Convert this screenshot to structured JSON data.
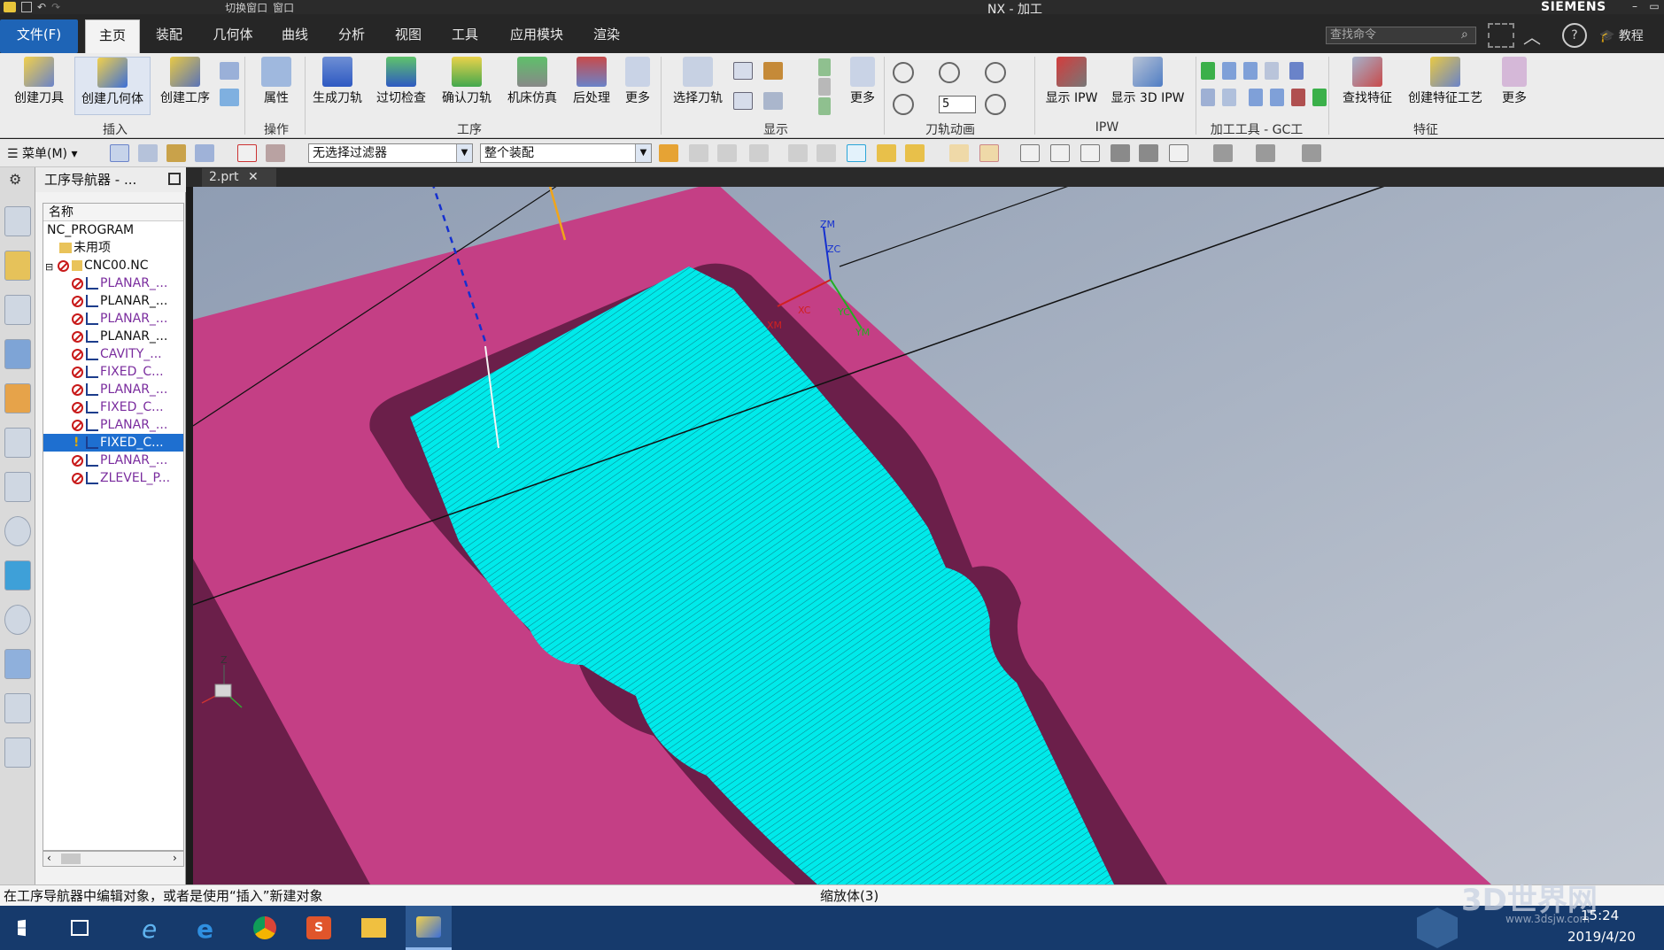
{
  "app": {
    "title": "NX - 加工",
    "brand": "SIEMENS",
    "quick_access": [
      "切换窗口",
      "窗口"
    ]
  },
  "menu": {
    "file": "文件(F)",
    "tabs": [
      "主页",
      "装配",
      "几何体",
      "曲线",
      "分析",
      "视图",
      "工具",
      "应用模块",
      "渲染"
    ],
    "active_tab": "主页",
    "search_placeholder": "查找命令",
    "tutorial": "教程"
  },
  "ribbon": {
    "insert": {
      "label": "插入",
      "buttons": [
        "创建刀具",
        "创建几何体",
        "创建工序"
      ]
    },
    "operate": {
      "label": "操作",
      "buttons": [
        "属性"
      ]
    },
    "process": {
      "label": "工序",
      "buttons": [
        "生成刀轨",
        "过切检查",
        "确认刀轨",
        "机床仿真",
        "后处理",
        "更多"
      ]
    },
    "display": {
      "label": "显示",
      "buttons": [
        "选择刀轨",
        "更多"
      ]
    },
    "animation": {
      "label": "刀轨动画",
      "speed": "5"
    },
    "ipw": {
      "label": "IPW",
      "buttons": [
        "显示 IPW",
        "显示 3D IPW"
      ]
    },
    "machining_tools": {
      "label": "加工工具 - GC工"
    },
    "features": {
      "label": "特征",
      "buttons": [
        "查找特征",
        "创建特征工艺",
        "更多"
      ]
    }
  },
  "toolbar": {
    "menu_label": "菜单(M)",
    "filter": "无选择过滤器",
    "scope": "整个装配"
  },
  "document_tab": "2.prt",
  "navigator": {
    "title": "工序导航器 - ...",
    "column": "名称",
    "root": "NC_PROGRAM",
    "unused": "未用项",
    "program": "CNC00.NC",
    "operations": [
      {
        "name": "PLANAR_...",
        "status": "stop",
        "color": "purple",
        "type": "planar"
      },
      {
        "name": "PLANAR_...",
        "status": "stop",
        "color": "black",
        "type": "planar"
      },
      {
        "name": "PLANAR_...",
        "status": "stop",
        "color": "purple",
        "type": "planar"
      },
      {
        "name": "PLANAR_...",
        "status": "stop",
        "color": "black",
        "type": "planar"
      },
      {
        "name": "CAVITY_...",
        "status": "stop",
        "color": "purple",
        "type": "cavity"
      },
      {
        "name": "FIXED_C...",
        "status": "stop",
        "color": "purple",
        "type": "fixed"
      },
      {
        "name": "PLANAR_...",
        "status": "stop",
        "color": "purple",
        "type": "planar"
      },
      {
        "name": "FIXED_C...",
        "status": "stop",
        "color": "purple",
        "type": "fixed"
      },
      {
        "name": "PLANAR_...",
        "status": "stop",
        "color": "purple",
        "type": "planar"
      },
      {
        "name": "FIXED_C...",
        "status": "warn",
        "color": "selected",
        "type": "fixed"
      },
      {
        "name": "PLANAR_...",
        "status": "stop",
        "color": "purple",
        "type": "planar"
      },
      {
        "name": "ZLEVEL_P...",
        "status": "stop",
        "color": "purple",
        "type": "zlevel"
      }
    ]
  },
  "viewport": {
    "axes": [
      "ZM",
      "ZC",
      "XC",
      "YC",
      "XM",
      "YM"
    ],
    "triad_z": "Z",
    "colors": {
      "part": "#c43f85",
      "wall": "#6b1f4a",
      "toolpath": "#00f0f0",
      "background": "#a9b3c3"
    }
  },
  "status": {
    "prompt": "在工序导航器中编辑对象，或者是使用“插入”新建对象",
    "right": "缩放体(3)"
  },
  "taskbar": {
    "time": "15:24",
    "date": "2019/4/20",
    "watermark": "3D世界网",
    "watermark_url": "www.3dsjw.com"
  }
}
